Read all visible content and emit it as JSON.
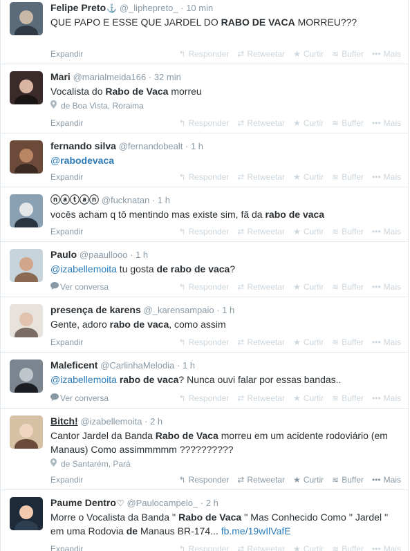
{
  "actions": {
    "reply": "Responder",
    "retweet": "Retweetar",
    "favorite": "Curtir",
    "buffer": "Buffer",
    "more": "Mais"
  },
  "expand_label": "Expandir",
  "convo_label": "Ver conversa",
  "tweets": [
    {
      "name": "Felipe Preto",
      "badge": "⚓",
      "handle": "@_liphepreto_",
      "time": "10 min",
      "segments": [
        {
          "t": "QUE PAPO E ESSE QUE JARDEL DO "
        },
        {
          "t": "RABO DE VACA",
          "b": true
        },
        {
          "t": " MORREU???"
        }
      ]
    },
    {
      "name": "Mari",
      "handle": "@marialmeida166",
      "time": "32 min",
      "segments": [
        {
          "t": "Vocalista do "
        },
        {
          "t": "Rabo de Vaca",
          "b": true
        },
        {
          "t": " morreu"
        }
      ],
      "geo": "de Boa Vista, Roraima"
    },
    {
      "name": "fernando silva",
      "handle": "@fernandobealt",
      "time": "1 h",
      "segments": [
        {
          "t": "@",
          "link": true
        },
        {
          "t": "rabodevaca",
          "link": true,
          "b": true
        }
      ]
    },
    {
      "name": "ⓝⓐⓣⓐⓝ",
      "handle": "@fucknatan",
      "time": "1 h",
      "segments": [
        {
          "t": "vocês acham q tô mentindo mas existe sim, fã da "
        },
        {
          "t": "rabo de vaca",
          "b": true
        }
      ]
    },
    {
      "name": "Paulo",
      "handle": "@paaullooo",
      "time": "1 h",
      "segments": [
        {
          "t": "@izabellemoita",
          "link": true
        },
        {
          "t": " tu gosta "
        },
        {
          "t": "de rabo de vaca",
          "b": true
        },
        {
          "t": "?"
        }
      ],
      "convo": true
    },
    {
      "name": "presença de karens",
      "handle": "@_karensampaio",
      "time": "1 h",
      "segments": [
        {
          "t": "Gente, adoro "
        },
        {
          "t": "rabo de vaca",
          "b": true
        },
        {
          "t": ", como assim"
        }
      ]
    },
    {
      "name": "Maleficent",
      "handle": "@CarlinhaMelodia",
      "time": "1 h",
      "segments": [
        {
          "t": "@izabellemoita",
          "link": true
        },
        {
          "t": " "
        },
        {
          "t": "rabo de vaca",
          "b": true
        },
        {
          "t": "? Nunca ouvi falar por essas bandas.."
        }
      ],
      "convo": true
    },
    {
      "name": "Bitch!",
      "handle": "@izabellemoita",
      "time": "2 h",
      "underline": true,
      "segments": [
        {
          "t": "Cantor Jardel da Banda "
        },
        {
          "t": "Rabo de Vaca",
          "b": true
        },
        {
          "t": " morreu em um acidente rodoviário (em Manaus)  Como assimmmmm ??????????"
        }
      ],
      "geo": "de Santarém, Pará",
      "hover": true
    },
    {
      "name": "Paume Dentro",
      "badge": "♡",
      "handle": "@Paulocampelo_",
      "time": "2 h",
      "segments": [
        {
          "t": "Morre o Vocalista da Banda '' "
        },
        {
          "t": "Rabo de Vaca",
          "b": true
        },
        {
          "t": " '' Mas Conhecido Como '' Jardel '' em uma Rodovia "
        },
        {
          "t": "de",
          "b": true
        },
        {
          "t": " Manaus BR-174... "
        },
        {
          "t": "fb.me/19wIlVafE",
          "link": true
        }
      ]
    }
  ]
}
